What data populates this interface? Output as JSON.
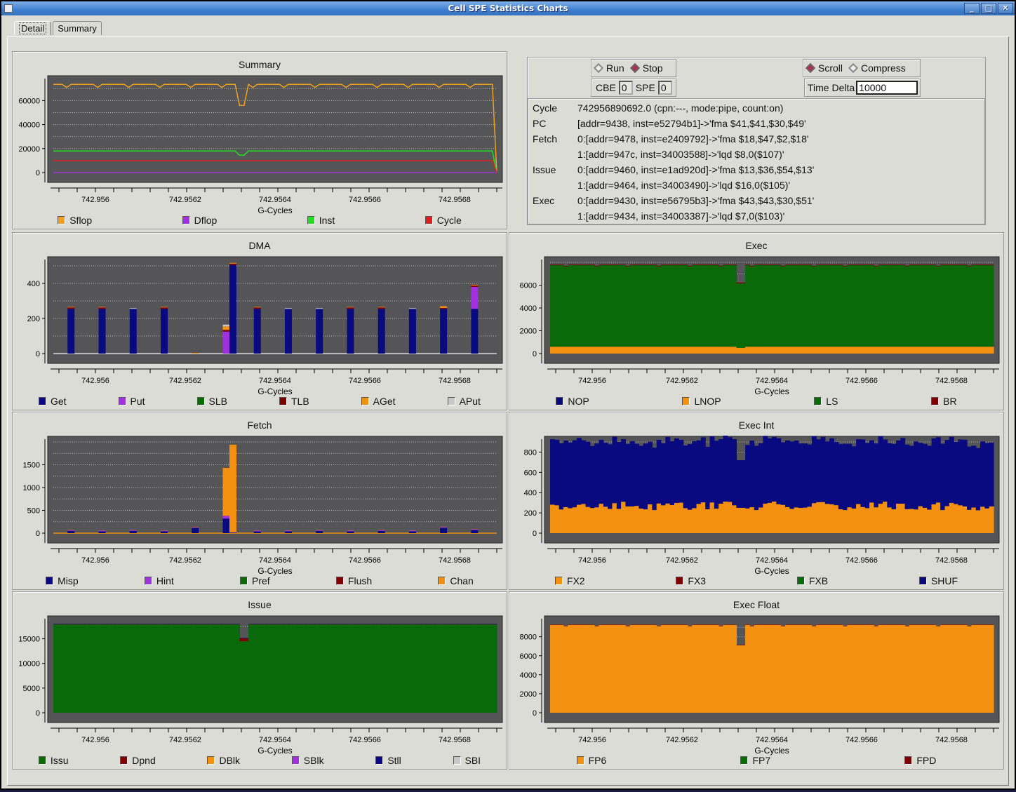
{
  "window": {
    "title": "Cell SPE Statistics Charts",
    "buttons": [
      "_",
      "□",
      "✕"
    ]
  },
  "tabs": [
    {
      "label": "Detail",
      "active": true
    },
    {
      "label": "Summary",
      "active": false
    }
  ],
  "controls": {
    "run_label": "Run",
    "run_selected": false,
    "stop_label": "Stop",
    "stop_selected": true,
    "cbe_label": "CBE",
    "cbe_value": "0",
    "spe_label": "SPE",
    "spe_value": "0",
    "scroll_label": "Scroll",
    "scroll_selected": true,
    "compress_label": "Compress",
    "compress_selected": false,
    "time_delta_label": "Time Delta",
    "time_delta_value": "10000"
  },
  "info": [
    {
      "label": "Cycle",
      "value": "742956890692.0 (cpn:---, mode:pipe, count:on)"
    },
    {
      "label": "PC",
      "value": "[addr=9438, inst=e52794b1]->'fma $41,$41,$30,$49'"
    },
    {
      "label": "Fetch",
      "value": "0:[addr=9478, inst=e2409792]->'fma $18,$47,$2,$18'"
    },
    {
      "label": "",
      "value": "1:[addr=947c, inst=34003588]->'lqd $8,0($107)'"
    },
    {
      "label": "Issue",
      "value": "0:[addr=9460, inst=e1ad920d]->'fma $13,$36,$54,$13'"
    },
    {
      "label": "",
      "value": "1:[addr=9464, inst=34003490]->'lqd $16,0($105)'"
    },
    {
      "label": "Exec",
      "value": "0:[addr=9430, inst=e56795b3]->'fma $43,$43,$30,$51'"
    },
    {
      "label": "",
      "value": "1:[addr=9434, inst=34003387]->'lqd $7,0($103)'"
    }
  ],
  "chart_data": [
    {
      "id": "summary",
      "title": "Summary",
      "type": "line",
      "xlabel": "G-Cycles",
      "xticks": [
        "742.956",
        "742.9562",
        "742.9564",
        "742.9566",
        "742.9568"
      ],
      "ylim": [
        0,
        76000
      ],
      "yticks": [
        0,
        20000,
        40000,
        60000
      ],
      "series": [
        {
          "name": "Sflop",
          "color": "#f0a020",
          "baseline": 73500,
          "dip": 56000,
          "end": 0
        },
        {
          "name": "Dflop",
          "color": "#a030e0",
          "baseline": 0,
          "dip": 0,
          "end": 0
        },
        {
          "name": "Inst",
          "color": "#20e020",
          "baseline": 18000,
          "dip": 14500,
          "end": 0
        },
        {
          "name": "Cycle",
          "color": "#e02020",
          "baseline": 10000,
          "dip": 10000,
          "end": 0
        }
      ]
    },
    {
      "id": "dma",
      "title": "DMA",
      "type": "bar",
      "xlabel": "G-Cycles",
      "xticks": [
        "742.956",
        "742.9562",
        "742.9564",
        "742.9566",
        "742.9568"
      ],
      "ylim": [
        0,
        520
      ],
      "yticks": [
        0,
        200,
        400
      ],
      "legend": [
        {
          "name": "Get",
          "color": "#0a0a80"
        },
        {
          "name": "Put",
          "color": "#a030e0"
        },
        {
          "name": "SLB",
          "color": "#0a6a0a"
        },
        {
          "name": "TLB",
          "color": "#800000"
        },
        {
          "name": "AGet",
          "color": "#f39010"
        },
        {
          "name": "APut",
          "color": "#c8c8c8"
        }
      ],
      "bars": [
        {
          "pos": 0.04,
          "Get": 255,
          "TLB": 8,
          "AGet": 3
        },
        {
          "pos": 0.11,
          "Get": 255,
          "TLB": 8,
          "AGet": 3
        },
        {
          "pos": 0.18,
          "Get": 255,
          "APut": 4
        },
        {
          "pos": 0.25,
          "Get": 255,
          "TLB": 8,
          "AGet": 3
        },
        {
          "pos": 0.32,
          "AGet": 4
        },
        {
          "pos": 0.39,
          "Put": 125,
          "TLB": 10,
          "AGet": 20,
          "APut": 10
        },
        {
          "pos": 0.405,
          "Get": 505,
          "TLB": 8,
          "AGet": 4
        },
        {
          "pos": 0.46,
          "Get": 255,
          "TLB": 8,
          "AGet": 3
        },
        {
          "pos": 0.53,
          "Get": 255,
          "APut": 4
        },
        {
          "pos": 0.6,
          "Get": 255,
          "APut": 4
        },
        {
          "pos": 0.67,
          "Get": 255,
          "TLB": 8,
          "AGet": 3
        },
        {
          "pos": 0.74,
          "Get": 255,
          "TLB": 8,
          "AGet": 3
        },
        {
          "pos": 0.81,
          "Get": 255,
          "APut": 4
        },
        {
          "pos": 0.88,
          "Get": 255,
          "TLB": 5,
          "AGet": 10
        },
        {
          "pos": 0.95,
          "Get": 255,
          "Put": 125,
          "TLB": 8,
          "AGet": 4
        }
      ]
    },
    {
      "id": "exec",
      "title": "Exec",
      "type": "area",
      "xlabel": "G-Cycles",
      "xticks": [
        "742.956",
        "742.9562",
        "742.9564",
        "742.9566",
        "742.9568"
      ],
      "ylim": [
        0,
        8000
      ],
      "yticks": [
        0,
        2000,
        4000,
        6000
      ],
      "legend": [
        {
          "name": "NOP",
          "color": "#0a0a80"
        },
        {
          "name": "LNOP",
          "color": "#f39010"
        },
        {
          "name": "LS",
          "color": "#0a6a0a"
        },
        {
          "name": "BR",
          "color": "#800000"
        }
      ],
      "stack": [
        {
          "name": "LNOP",
          "color": "#f39010",
          "base": 600,
          "dip": 500
        },
        {
          "name": "LS",
          "color": "#0a6a0a",
          "base": 7150,
          "dip": 5650
        },
        {
          "name": "BR",
          "color": "#800000",
          "base": 60,
          "dip": 80
        }
      ]
    },
    {
      "id": "fetch",
      "title": "Fetch",
      "type": "bar",
      "xlabel": "G-Cycles",
      "xticks": [
        "742.956",
        "742.9562",
        "742.9564",
        "742.9566",
        "742.9568"
      ],
      "ylim": [
        0,
        2000
      ],
      "yticks": [
        0,
        500,
        1000,
        1500
      ],
      "legend": [
        {
          "name": "Misp",
          "color": "#0a0a80"
        },
        {
          "name": "Hint",
          "color": "#a030e0"
        },
        {
          "name": "Pref",
          "color": "#0a6a0a"
        },
        {
          "name": "Flush",
          "color": "#800000"
        },
        {
          "name": "Chan",
          "color": "#f39010"
        }
      ],
      "bars": [
        {
          "pos": 0.04,
          "Misp": 50,
          "Hint": 15,
          "Chan": 5
        },
        {
          "pos": 0.11,
          "Misp": 40,
          "Hint": 15,
          "Chan": 5
        },
        {
          "pos": 0.18,
          "Misp": 50,
          "Hint": 15,
          "Chan": 5
        },
        {
          "pos": 0.25,
          "Misp": 40,
          "Hint": 15,
          "Chan": 5
        },
        {
          "pos": 0.32,
          "Misp": 120,
          "Hint": 10,
          "Chan": 8
        },
        {
          "pos": 0.39,
          "Misp": 320,
          "Hint": 60,
          "Chan": 1050
        },
        {
          "pos": 0.405,
          "Misp": 10,
          "Hint": 10,
          "Chan": 1920
        },
        {
          "pos": 0.46,
          "Misp": 40,
          "Hint": 15,
          "Chan": 5
        },
        {
          "pos": 0.53,
          "Misp": 40,
          "Hint": 15,
          "Chan": 5
        },
        {
          "pos": 0.6,
          "Misp": 50,
          "Hint": 15,
          "Chan": 5
        },
        {
          "pos": 0.67,
          "Misp": 40,
          "Hint": 15,
          "Chan": 5
        },
        {
          "pos": 0.74,
          "Misp": 50,
          "Hint": 15,
          "Chan": 5
        },
        {
          "pos": 0.81,
          "Misp": 40,
          "Hint": 15,
          "Chan": 5
        },
        {
          "pos": 0.88,
          "Misp": 120,
          "Hint": 15,
          "Chan": 5
        },
        {
          "pos": 0.95,
          "Misp": 70,
          "Hint": 15,
          "Chan": 5
        }
      ]
    },
    {
      "id": "execint",
      "title": "Exec Int",
      "type": "area",
      "xlabel": "G-Cycles",
      "xticks": [
        "742.956",
        "742.9562",
        "742.9564",
        "742.9566",
        "742.9568"
      ],
      "ylim": [
        0,
        900
      ],
      "yticks": [
        0,
        200,
        400,
        600,
        800
      ],
      "legend": [
        {
          "name": "FX2",
          "color": "#f39010"
        },
        {
          "name": "FX3",
          "color": "#800000"
        },
        {
          "name": "FXB",
          "color": "#0a6a0a"
        },
        {
          "name": "SHUF",
          "color": "#0a0a80"
        }
      ],
      "stack": [
        {
          "name": "FX2",
          "color": "#f39010",
          "base": 225,
          "jitter": 90,
          "dip": 250
        },
        {
          "name": "SHUF",
          "color": "#0a0a80",
          "base": 610,
          "jitter": 60,
          "dip": 470
        }
      ]
    },
    {
      "id": "issue",
      "title": "Issue",
      "type": "area",
      "xlabel": "G-Cycles",
      "xticks": [
        "742.956",
        "742.9562",
        "742.9564",
        "742.9566",
        "742.9568"
      ],
      "ylim": [
        0,
        18500
      ],
      "yticks": [
        0,
        5000,
        10000,
        15000
      ],
      "legend": [
        {
          "name": "Issu",
          "color": "#0a6a0a"
        },
        {
          "name": "Dpnd",
          "color": "#800000"
        },
        {
          "name": "DBlk",
          "color": "#f39010"
        },
        {
          "name": "SBlk",
          "color": "#a030e0"
        },
        {
          "name": "Stll",
          "color": "#0a0a80"
        },
        {
          "name": "SBI",
          "color": "#c8c8c8"
        }
      ],
      "stack": [
        {
          "name": "Issu",
          "color": "#0a6a0a",
          "base": 17900,
          "dip": 14500
        },
        {
          "name": "Dpnd",
          "color": "#800000",
          "base": 60,
          "dip": 600
        },
        {
          "name": "Stll",
          "color": "#0a0a80",
          "base": 80,
          "dip": 80
        }
      ]
    },
    {
      "id": "execfloat",
      "title": "Exec Float",
      "type": "area",
      "xlabel": "G-Cycles",
      "xticks": [
        "742.956",
        "742.9562",
        "742.9564",
        "742.9566",
        "742.9568"
      ],
      "ylim": [
        0,
        9600
      ],
      "yticks": [
        0,
        2000,
        4000,
        6000,
        8000
      ],
      "legend": [
        {
          "name": "FP6",
          "color": "#f39010"
        },
        {
          "name": "FP7",
          "color": "#0a6a0a"
        },
        {
          "name": "FPD",
          "color": "#800000"
        }
      ],
      "stack": [
        {
          "name": "FP6",
          "color": "#f39010",
          "base": 9250,
          "dip": 7100
        },
        {
          "name": "FPD",
          "color": "#800000",
          "base": 40,
          "dip": 40
        }
      ]
    }
  ]
}
